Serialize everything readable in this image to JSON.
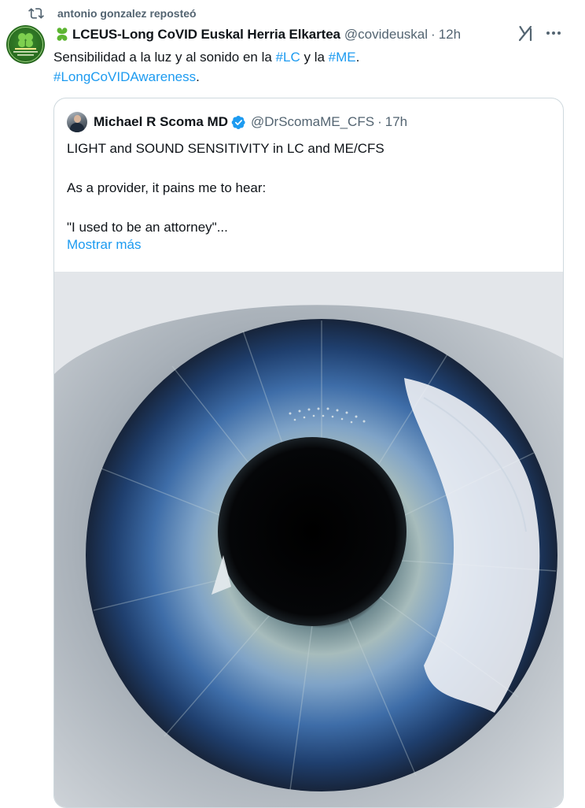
{
  "retweet": {
    "text": "antonio gonzalez reposteó"
  },
  "author": {
    "clover": "🍀",
    "name": "LCEUS-Long CoVID Euskal Herria Elkartea",
    "handle": "@covideuskal",
    "separator": "·",
    "time": "12h",
    "avatar_icon": "lceus-clover-logo"
  },
  "tweet": {
    "text_before": "Sensibilidad a la luz y al sonido en la ",
    "tag1": "#LC",
    "text_mid": " y la ",
    "tag2": "#ME",
    "text_after": ".",
    "tag3": "#LongCoVIDAwareness",
    "text_end": "."
  },
  "quote": {
    "name": "Michael R Scoma MD",
    "handle": "@DrScomaME_CFS",
    "separator": "·",
    "time": "17h",
    "line1": "LIGHT and SOUND SENSITIVITY in LC and ME/CFS",
    "line2": "As a provider, it pains me to hear:",
    "line3": "\"I used to be an attorney\"...",
    "show_more": "Mostrar más",
    "image_icon": "eye-iris-photo"
  },
  "colors": {
    "accent": "#1d9bf0",
    "text": "#0f1419",
    "muted": "#536471",
    "border": "#cfd9de"
  },
  "icons": {
    "retweet": "retweet-icon",
    "grok": "grok-icon",
    "more": "more-icon",
    "verified": "verified-badge-icon"
  }
}
